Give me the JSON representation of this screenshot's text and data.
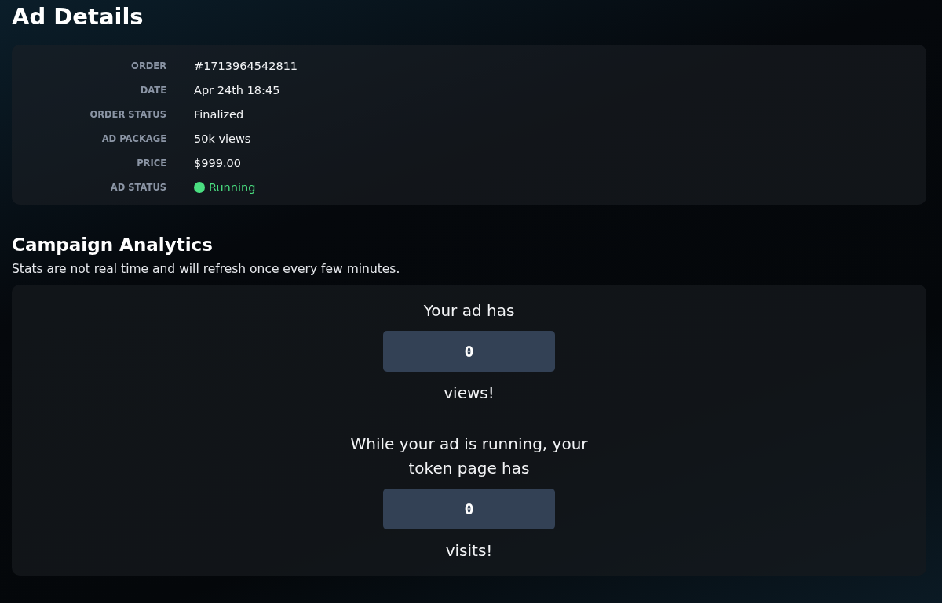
{
  "title": "Ad Details",
  "details": [
    {
      "label": "ORDER",
      "value": "#1713964542811",
      "kind": "text"
    },
    {
      "label": "DATE",
      "value": "Apr 24th 18:45",
      "kind": "text"
    },
    {
      "label": "ORDER STATUS",
      "value": "Finalized",
      "kind": "text"
    },
    {
      "label": "AD PACKAGE",
      "value": "50k views",
      "kind": "text"
    },
    {
      "label": "PRICE",
      "value": "$999.00",
      "kind": "text"
    },
    {
      "label": "AD STATUS",
      "value": "Running",
      "kind": "status",
      "color": "#4ade80"
    }
  ],
  "analytics": {
    "heading": "Campaign Analytics",
    "note": "Stats are not real time and will refresh once every few minutes.",
    "stats": [
      {
        "before": "Your ad has",
        "value": "0",
        "after": "views!"
      },
      {
        "before": "While your ad is running, your token page has",
        "value": "0",
        "after": "visits!"
      }
    ]
  }
}
